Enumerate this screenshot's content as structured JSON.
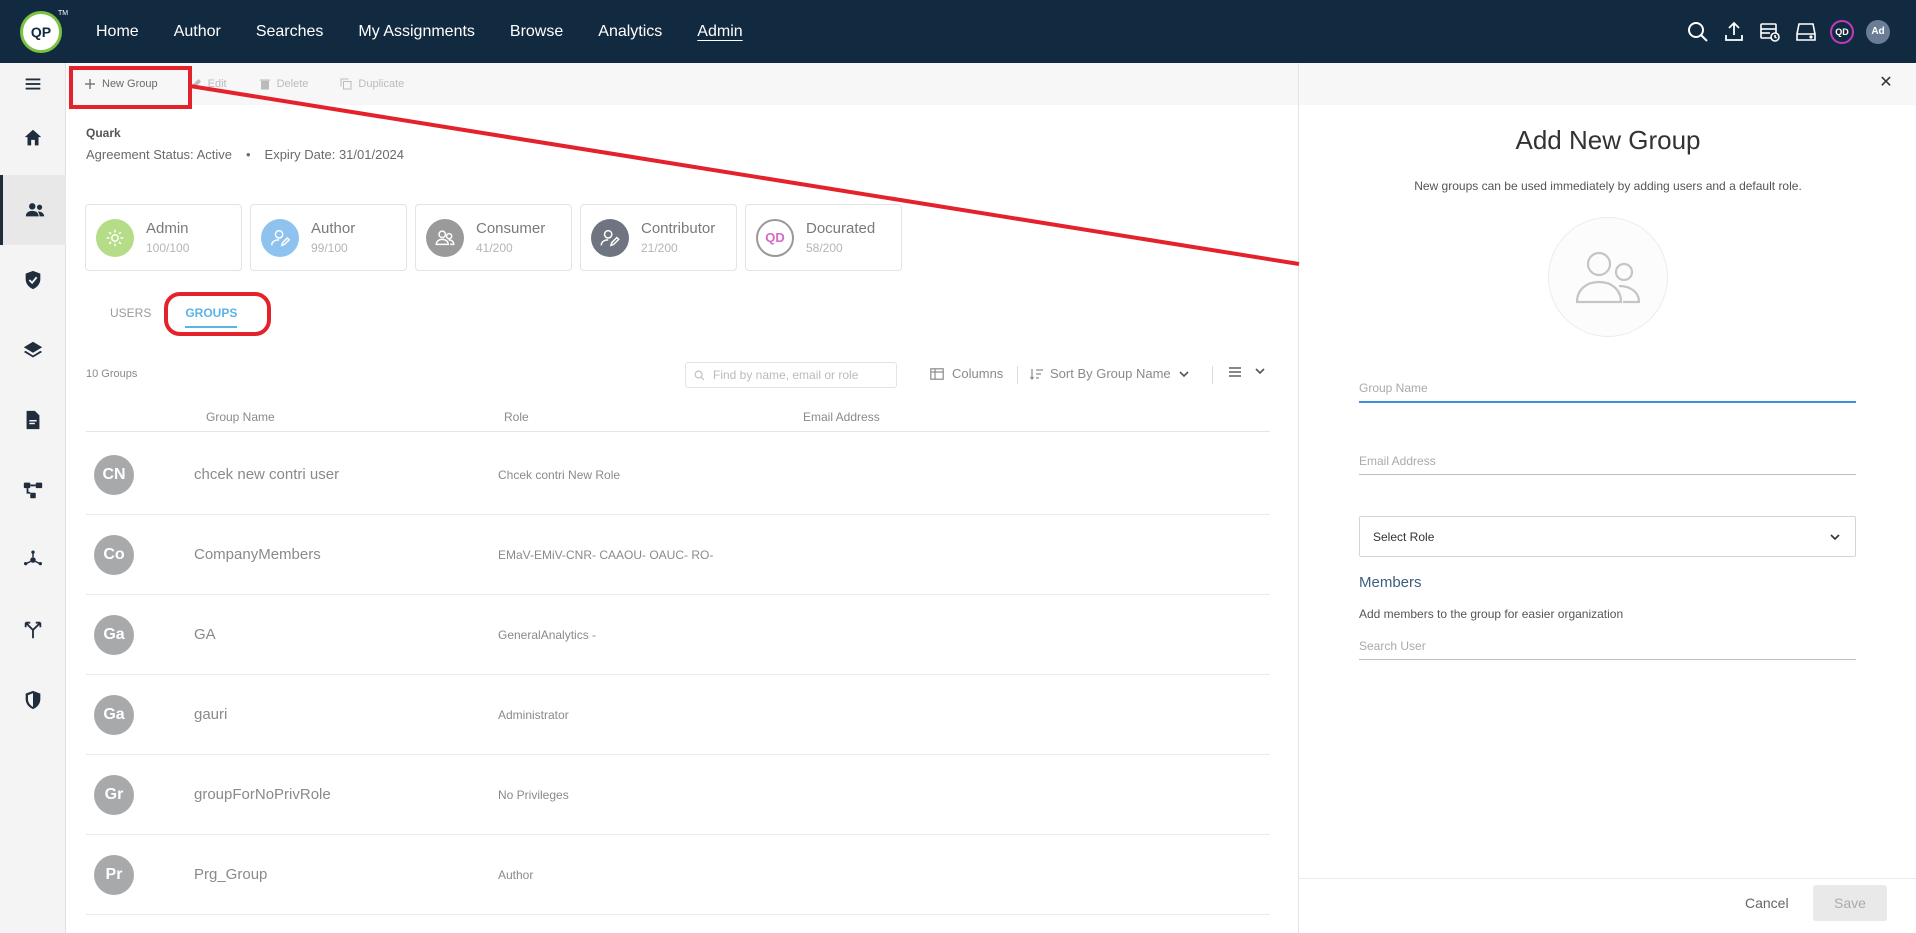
{
  "nav": {
    "logo": "QP",
    "logo_tm": "TM",
    "items": [
      "Home",
      "Author",
      "Searches",
      "My Assignments",
      "Browse",
      "Analytics",
      "Admin"
    ],
    "active": "Admin",
    "avatar_qd": "QD",
    "avatar_user": "Ad"
  },
  "toolbar": {
    "new_group": "New Group",
    "edit": "Edit",
    "delete": "Delete",
    "duplicate": "Duplicate"
  },
  "org": {
    "name": "Quark",
    "agreement_status": "Agreement Status: Active",
    "expiry": "Expiry Date: 31/01/2024"
  },
  "licenses": [
    {
      "name": "Admin",
      "count": "100/100",
      "color": "#b5dc87"
    },
    {
      "name": "Author",
      "count": "99/100",
      "color": "#8ec3f0"
    },
    {
      "name": "Consumer",
      "count": "41/200",
      "color": "#9a9a9a"
    },
    {
      "name": "Contributor",
      "count": "21/200",
      "color": "#6f7580"
    },
    {
      "name": "Docurated",
      "count": "58/200",
      "color": "#d667c9"
    }
  ],
  "tabs": {
    "users": "USERS",
    "groups": "GROUPS",
    "active": "GROUPS"
  },
  "list": {
    "count_label": "10 Groups",
    "search_placeholder": "Find by name, email or role",
    "columns_label": "Columns",
    "sort_label": "Sort By Group Name",
    "headers": {
      "name": "Group Name",
      "role": "Role",
      "email": "Email Address"
    },
    "rows": [
      {
        "initials": "CN",
        "name": "chcek new contri user",
        "role": "Chcek contri New Role"
      },
      {
        "initials": "Co",
        "name": "CompanyMembers",
        "role": "EMaV-EMiV-CNR- CAAOU- OAUC- RO-"
      },
      {
        "initials": "Ga",
        "name": "GA",
        "role": "GeneralAnalytics -"
      },
      {
        "initials": "Ga",
        "name": "gauri",
        "role": "Administrator"
      },
      {
        "initials": "Gr",
        "name": "groupForNoPrivRole",
        "role": "No Privileges"
      },
      {
        "initials": "Pr",
        "name": "Prg_Group",
        "role": "Author"
      }
    ]
  },
  "panel": {
    "title": "Add New Group",
    "subtitle": "New groups can be used immediately by adding users and a default role.",
    "group_name_placeholder": "Group Name",
    "email_placeholder": "Email Address",
    "select_role": "Select Role",
    "members_title": "Members",
    "members_sub": "Add members to the group for easier organization",
    "search_user_placeholder": "Search User",
    "cancel": "Cancel",
    "save": "Save"
  },
  "annotation_color": "#e3222b"
}
